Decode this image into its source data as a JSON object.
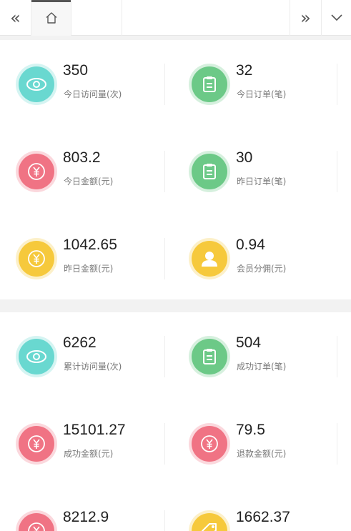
{
  "topbar": {
    "left_icon": "double-chevron-left-icon",
    "home_icon": "home-icon",
    "right_icon": "double-chevron-right-icon",
    "down_icon": "chevron-down-icon"
  },
  "colors": {
    "teal": "#69d8d0",
    "green": "#6cc987",
    "red": "#f07384",
    "yellow": "#f6c93c"
  },
  "section1": {
    "items": [
      {
        "value": "350",
        "label": "今日访问量(次)",
        "icon": "eye-icon",
        "color": "teal"
      },
      {
        "value": "32",
        "label": "今日订单(笔)",
        "icon": "clipboard-icon",
        "color": "green"
      },
      {
        "value": "803.2",
        "label": "今日金额(元)",
        "icon": "yen-icon",
        "color": "red"
      },
      {
        "value": "30",
        "label": "昨日订单(笔)",
        "icon": "clipboard-icon",
        "color": "green"
      },
      {
        "value": "1042.65",
        "label": "昨日金额(元)",
        "icon": "yen-icon",
        "color": "yellow"
      },
      {
        "value": "0.94",
        "label": "会员分佣(元)",
        "icon": "user-icon",
        "color": "yellow"
      }
    ]
  },
  "section2": {
    "items": [
      {
        "value": "6262",
        "label": "累计访问量(次)",
        "icon": "eye-icon",
        "color": "teal"
      },
      {
        "value": "504",
        "label": "成功订单(笔)",
        "icon": "clipboard-icon",
        "color": "green"
      },
      {
        "value": "15101.27",
        "label": "成功金额(元)",
        "icon": "yen-icon",
        "color": "red"
      },
      {
        "value": "79.5",
        "label": "退款金额(元)",
        "icon": "yen-icon",
        "color": "red"
      },
      {
        "value": "8212.9",
        "label": "",
        "icon": "yen-icon",
        "color": "red"
      },
      {
        "value": "1662.37",
        "label": "",
        "icon": "tag-icon",
        "color": "yellow"
      }
    ]
  }
}
